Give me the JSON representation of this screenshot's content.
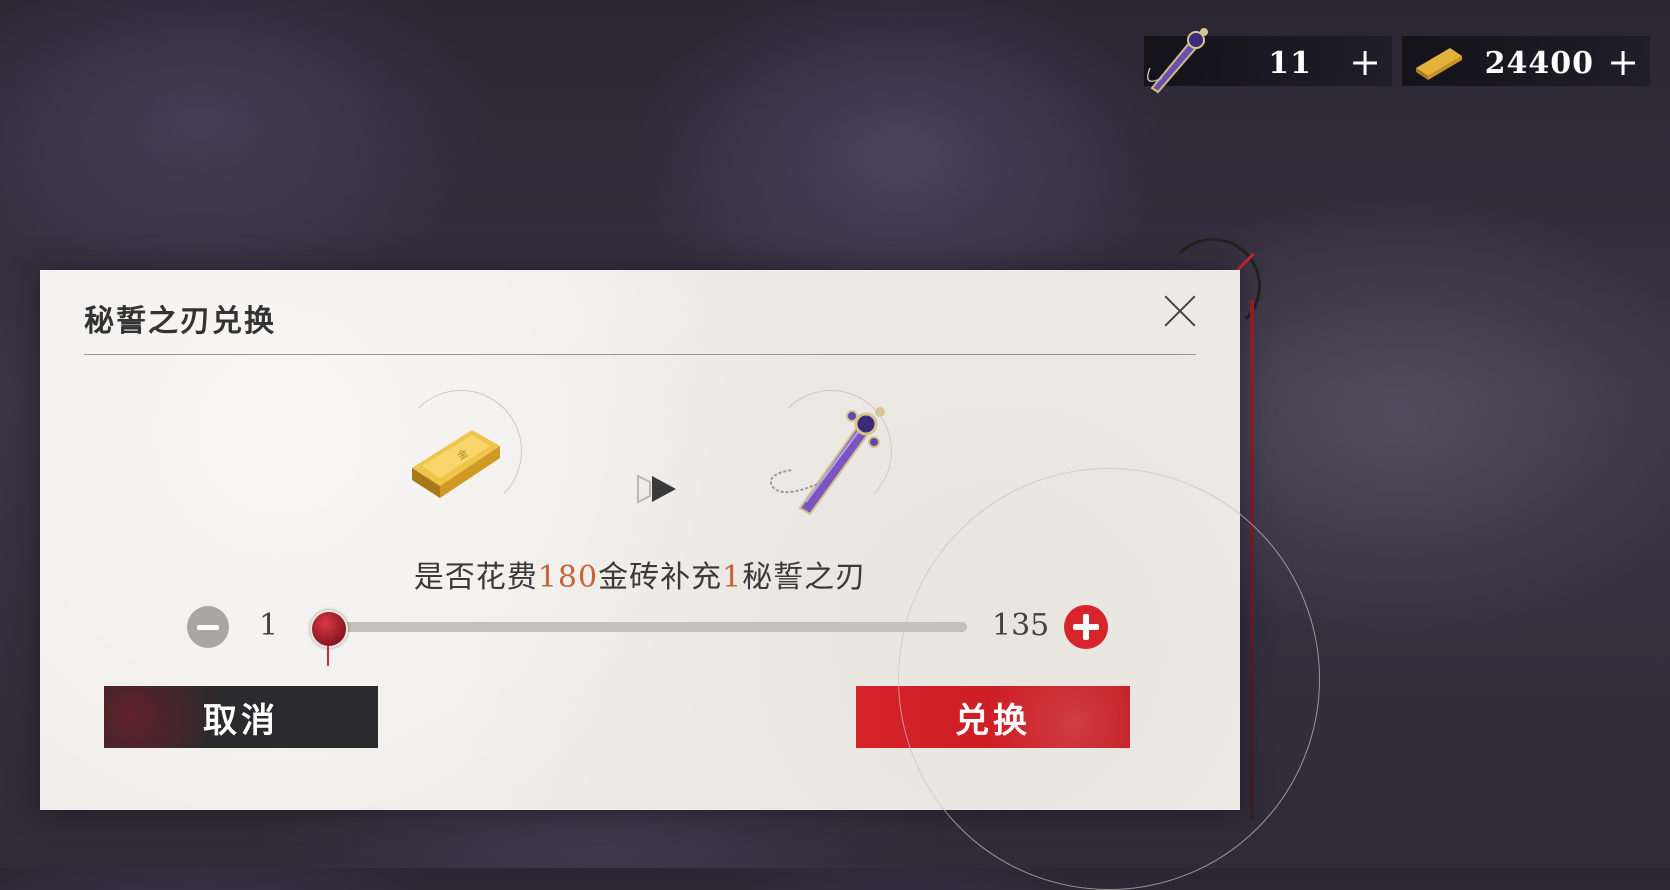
{
  "top_bar": {
    "blade_count": "11",
    "gold_count": "24400",
    "plus_label": "+"
  },
  "dialog": {
    "title": "秘誓之刃兑换",
    "exchange_text": {
      "part1": "是否花费",
      "cost": "180",
      "part2": "金砖补充",
      "amount": "1",
      "part3": "秘誓之刃"
    },
    "slider": {
      "min_label": "1",
      "max_label": "135",
      "current": 1,
      "min": 1,
      "max": 135
    },
    "cancel_label": "取消",
    "confirm_label": "兑换"
  },
  "colors": {
    "accent_red": "#d7232c",
    "highlight_orange": "#c76437",
    "dark_button": "#2b2a2c"
  },
  "icons": {
    "blade": "purple-dagger-icon",
    "gold": "gold-bar-icon",
    "arrow": "play-arrow-icon",
    "close": "close-icon"
  }
}
